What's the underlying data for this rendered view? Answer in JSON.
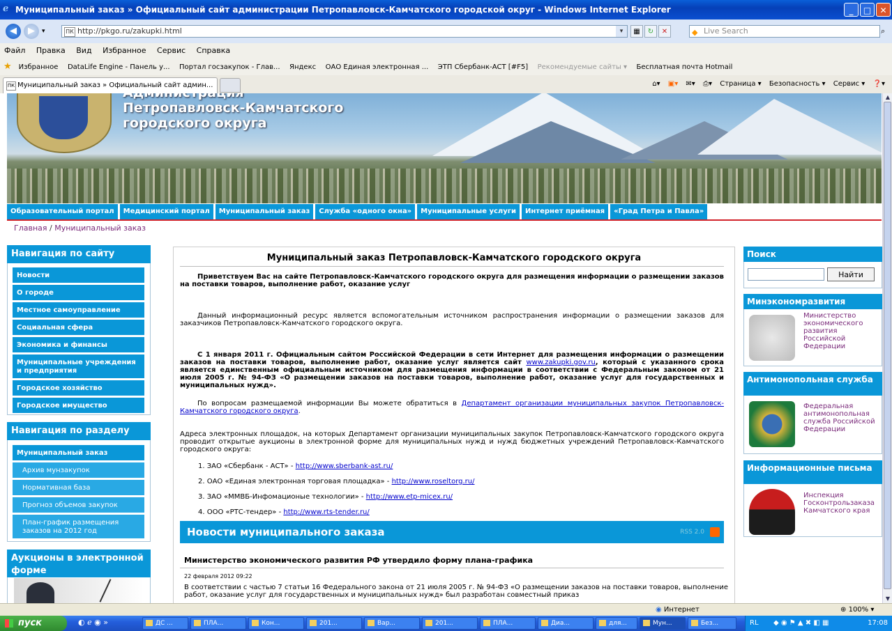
{
  "window": {
    "title": "Муниципальный заказ » Официальный сайт администрации Петропавловск-Камчатского городской округ - Windows Internet Explorer",
    "minimize": "_",
    "maximize": "□",
    "close": "✕"
  },
  "address": {
    "url": "http://pkgo.ru/zakupki.html",
    "search_placeholder": "Live Search"
  },
  "menu": [
    "Файл",
    "Правка",
    "Вид",
    "Избранное",
    "Сервис",
    "Справка"
  ],
  "favorites": {
    "label": "Избранное",
    "items": [
      "DataLife Engine - Панель у...",
      "Портал госзакупок - Глав...",
      "Яндекс",
      "ОАО Единая электронная ...",
      "ЭТП Сбербанк-АСТ [#F5]",
      "Рекомендуемые сайты ▾",
      "Бесплатная почта Hotmail"
    ]
  },
  "tab": {
    "label": "Муниципальный заказ » Официальный сайт админ..."
  },
  "commandbar": [
    "Страница ▾",
    "Безопасность ▾",
    "Сервис ▾"
  ],
  "banner": {
    "line1": "Администрация",
    "line2": "Петропавловск-Камчатского",
    "line3": "городского округа"
  },
  "topnav": [
    "Образовательный портал",
    "Медицинский портал",
    "Муниципальный заказ",
    "Служба «одного окна»",
    "Муниципальные услуги",
    "Интернет приёмная",
    "«Град Петра и Павла»"
  ],
  "breadcrumb": {
    "home": "Главная",
    "sep": "/",
    "current": "Муниципальный заказ"
  },
  "sidebar": {
    "nav_title": "Навигация по сайту",
    "nav_items": [
      "Новости",
      "О городе",
      "Местное самоуправление",
      "Социальная сфера",
      "Экономика и финансы",
      "Муниципальные учреждения и предприятия",
      "Городское хозяйство",
      "Городское имущество"
    ],
    "section_title": "Навигация по разделу",
    "section_main": "Муниципальный заказ",
    "section_items": [
      "Архив мунзакупок",
      "Нормативная база",
      "Прогноз объемов закупок",
      "План-график размещения заказов на 2012 год"
    ],
    "auctions_title": "Аукционы в электронной форме"
  },
  "content": {
    "title": "Муниципальный заказ Петропавловск-Камчатского городского округа",
    "welcome": "Приветствуем Вас на сайте Петропавловск-Камчатского городского округа для размещения информации о размещении заказов на поставки товаров, выполнение работ, оказание услуг",
    "para1": "Данный информационный ресурс является вспомогательным источником распространения информации о размещении заказов для заказчиков Петропавловск-Камчатского городского округа.",
    "para2_a": "С 1 января 2011 г. Официальным сайтом Российской Федерации в сети Интернет для размещения информации о размещении заказов на поставки товаров, выполнение работ, оказание услуг является сайт ",
    "para2_link": "www.zakupki.gov.ru",
    "para2_b": ", который с указанного срока является единственным официальным источником для размещения информации в соответствии с Федеральным законом от 21 июля 2005 г. № 94-ФЗ «О размещении заказов на поставки товаров, выполнение работ, оказание услуг для государственных и муниципальных нужд».",
    "para3_a": "По вопросам размещаемой информации Вы можете обратиться в ",
    "para3_link": "Департамент организации муниципальных закупок Петропавловск-Камчатского городского округа",
    "para3_b": ".",
    "para4": "Адреса электронных площадок, на которых Департамент организации муниципальных закупок Петропавловск-Камчатского городского округа проводит открытые аукционы в электронной форме для муниципальных нужд и нужд бюджетных учреждений Петропавловск-Камчатского городского округа:",
    "platforms": [
      {
        "text": "1. ЗАО «Сбербанк - АСТ» - ",
        "link": "http://www.sberbank-ast.ru/"
      },
      {
        "text": "2. ОАО «Единая электронная торговая площадка» - ",
        "link": "http://www.roseltorg.ru/"
      },
      {
        "text": "3. ЗАО «ММВБ-Инфомационые технологии» - ",
        "link": "http://www.etp-micex.ru/"
      },
      {
        "text": "4. ООО «РТС-тендер» - ",
        "link": "http://www.rts-tender.ru/"
      }
    ],
    "news_title": "Новости муниципального заказа",
    "rss": "RSS 2.0",
    "news_headline": "Министерство экономического развития РФ утвердило форму плана-графика",
    "news_date": "22 февраля 2012 09:22",
    "news_text": "В соответствии с частью 7 статьи 16 Федерального закона от 21 июля 2005 г. № 94-ФЗ «О размещении заказов на поставки товаров, выполнение работ, оказание услуг для государственных и муниципальных нужд» был разработан совместный приказ"
  },
  "right": {
    "search_title": "Поиск",
    "search_button": "Найти",
    "minek_title": "Минэкономразвития",
    "minek_link": "Министерство экономического развития Российской Федерации",
    "antimon_title": "Антимонопольная служба",
    "antimon_link": "Федеральная антимонопольная служба Российской Федерации",
    "info_title": "Информационные письма",
    "info_link": "Инспекция Госконтрользаказа Камчатского края"
  },
  "status": {
    "zone": "Интернет",
    "zoom": "100%"
  },
  "taskbar": {
    "start": "пуск",
    "tasks": [
      "ДС ...",
      "ПЛА...",
      "Кон...",
      "201...",
      "Вар...",
      "201...",
      "ПЛА...",
      "Диа...",
      "для...",
      "Мун...",
      "Без..."
    ],
    "lang": "RL",
    "clock": "17:08"
  },
  "colors": {
    "accent": "#0a97d8",
    "red": "#d2232a",
    "link": "#0000cc",
    "visited": "#7a2a7a"
  }
}
